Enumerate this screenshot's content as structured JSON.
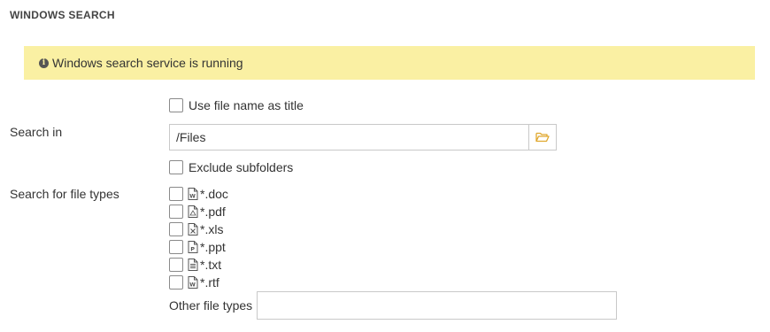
{
  "section": {
    "title": "WINDOWS SEARCH"
  },
  "status": {
    "message": "Windows search service is running",
    "icon": "info-circle-icon",
    "background": "#faf0a3"
  },
  "options": {
    "use_file_name_label": "Use file name as title",
    "exclude_subfolders_label": "Exclude subfolders"
  },
  "search_in": {
    "label": "Search in",
    "value": "/Files",
    "browse_icon": "folder-open-icon",
    "browse_icon_color": "#e0a82e"
  },
  "file_types": {
    "label": "Search for file types",
    "items": [
      {
        "ext": "*.doc",
        "icon": "word-file-icon"
      },
      {
        "ext": "*.pdf",
        "icon": "pdf-file-icon"
      },
      {
        "ext": "*.xls",
        "icon": "excel-file-icon"
      },
      {
        "ext": "*.ppt",
        "icon": "powerpoint-file-icon"
      },
      {
        "ext": "*.txt",
        "icon": "text-file-icon"
      },
      {
        "ext": "*.rtf",
        "icon": "word-file-icon"
      }
    ],
    "other_label": "Other file types",
    "other_value": ""
  }
}
